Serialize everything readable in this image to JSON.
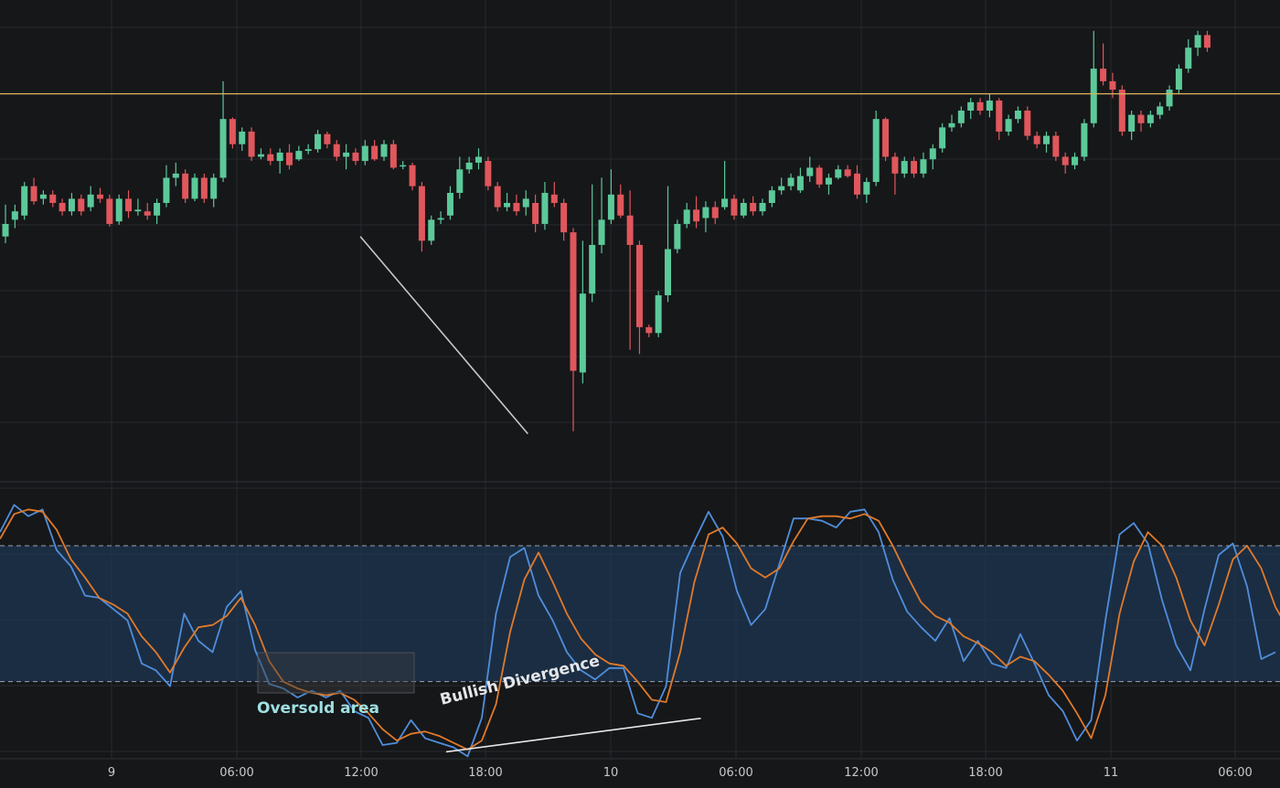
{
  "chart_data": [
    {
      "type": "candlestick",
      "title": "",
      "colors": {
        "up": "#5cc99a",
        "down": "#e0575c",
        "resistance": "#e0b15a",
        "grid": "#262a30"
      },
      "x_tick_labels": [
        "9",
        "06:00",
        "12:00",
        "18:00",
        "10",
        "06:00",
        "12:00",
        "18:00",
        "11",
        "06:00"
      ],
      "price_range": [
        -460,
        90
      ],
      "resistance_level": 0,
      "candles": [
        [
          -170,
          -155,
          -132,
          -178
        ],
        [
          -150,
          -140,
          -132,
          -160
        ],
        [
          -145,
          -110,
          -105,
          -150
        ],
        [
          -110,
          -128,
          -100,
          -132
        ],
        [
          -125,
          -120,
          -115,
          -132
        ],
        [
          -120,
          -130,
          -115,
          -135
        ],
        [
          -130,
          -140,
          -125,
          -145
        ],
        [
          -140,
          -125,
          -118,
          -145
        ],
        [
          -125,
          -140,
          -120,
          -145
        ],
        [
          -135,
          -120,
          -110,
          -140
        ],
        [
          -120,
          -125,
          -112,
          -130
        ],
        [
          -125,
          -155,
          -120,
          -158
        ],
        [
          -152,
          -125,
          -120,
          -156
        ],
        [
          -125,
          -140,
          -115,
          -148
        ],
        [
          -140,
          -138,
          -125,
          -145
        ],
        [
          -140,
          -145,
          -130,
          -150
        ],
        [
          -145,
          -130,
          -125,
          -155
        ],
        [
          -130,
          -100,
          -85,
          -135
        ],
        [
          -100,
          -95,
          -82,
          -110
        ],
        [
          -95,
          -125,
          -90,
          -130
        ],
        [
          -125,
          -100,
          -95,
          -128
        ],
        [
          -100,
          -125,
          -95,
          -130
        ],
        [
          -125,
          -100,
          -95,
          -135
        ],
        [
          -100,
          -30,
          15,
          -105
        ],
        [
          -30,
          -60,
          -28,
          -65
        ],
        [
          -60,
          -45,
          -40,
          -68
        ],
        [
          -45,
          -75,
          -40,
          -80
        ],
        [
          -75,
          -72,
          -65,
          -78
        ],
        [
          -72,
          -80,
          -65,
          -85
        ],
        [
          -80,
          -70,
          -65,
          -95
        ],
        [
          -70,
          -85,
          -60,
          -90
        ],
        [
          -78,
          -68,
          -62,
          -80
        ],
        [
          -68,
          -66,
          -60,
          -72
        ],
        [
          -66,
          -48,
          -43,
          -70
        ],
        [
          -48,
          -60,
          -45,
          -65
        ],
        [
          -60,
          -75,
          -55,
          -80
        ],
        [
          -75,
          -70,
          -60,
          -90
        ],
        [
          -70,
          -80,
          -65,
          -85
        ],
        [
          -80,
          -62,
          -55,
          -85
        ],
        [
          -62,
          -78,
          -55,
          -80
        ],
        [
          -75,
          -60,
          -55,
          -80
        ],
        [
          -60,
          -88,
          -55,
          -90
        ],
        [
          -86,
          -85,
          -80,
          -90
        ],
        [
          -85,
          -110,
          -82,
          -115
        ],
        [
          -110,
          -175,
          -105,
          -188
        ],
        [
          -175,
          -150,
          -145,
          -180
        ],
        [
          -150,
          -148,
          -140,
          -155
        ],
        [
          -145,
          -118,
          -110,
          -150
        ],
        [
          -118,
          -90,
          -75,
          -125
        ],
        [
          -90,
          -82,
          -75,
          -95
        ],
        [
          -82,
          -75,
          -65,
          -90
        ],
        [
          -80,
          -110,
          -75,
          -115
        ],
        [
          -110,
          -135,
          -105,
          -140
        ],
        [
          -135,
          -130,
          -118,
          -140
        ],
        [
          -130,
          -140,
          -120,
          -145
        ],
        [
          -135,
          -125,
          -115,
          -145
        ],
        [
          -130,
          -155,
          -120,
          -165
        ],
        [
          -155,
          -118,
          -105,
          -162
        ],
        [
          -120,
          -130,
          -105,
          -135
        ],
        [
          -130,
          -165,
          -125,
          -175
        ],
        [
          -165,
          -330,
          -160,
          -402
        ],
        [
          -332,
          -238,
          -175,
          -345
        ],
        [
          -238,
          -180,
          -108,
          -248
        ],
        [
          -180,
          -150,
          -100,
          -190
        ],
        [
          -150,
          -120,
          -90,
          -155
        ],
        [
          -120,
          -145,
          -108,
          -148
        ],
        [
          -145,
          -180,
          -115,
          -305
        ],
        [
          -180,
          -278,
          -175,
          -310
        ],
        [
          -278,
          -285,
          -275,
          -290
        ],
        [
          -285,
          -240,
          -235,
          -290
        ],
        [
          -240,
          -185,
          -110,
          -248
        ],
        [
          -185,
          -155,
          -150,
          -190
        ],
        [
          -155,
          -138,
          -130,
          -160
        ],
        [
          -138,
          -152,
          -122,
          -160
        ],
        [
          -148,
          -135,
          -128,
          -165
        ],
        [
          -135,
          -148,
          -128,
          -155
        ],
        [
          -135,
          -125,
          -80,
          -138
        ],
        [
          -125,
          -145,
          -120,
          -150
        ],
        [
          -145,
          -130,
          -125,
          -148
        ],
        [
          -130,
          -140,
          -122,
          -145
        ],
        [
          -140,
          -130,
          -125,
          -145
        ],
        [
          -130,
          -115,
          -110,
          -135
        ],
        [
          -115,
          -110,
          -100,
          -120
        ],
        [
          -110,
          -100,
          -95,
          -115
        ],
        [
          -115,
          -98,
          -88,
          -118
        ],
        [
          -98,
          -88,
          -75,
          -105
        ],
        [
          -88,
          -108,
          -85,
          -112
        ],
        [
          -108,
          -100,
          -95,
          -120
        ],
        [
          -100,
          -90,
          -85,
          -102
        ],
        [
          -90,
          -98,
          -85,
          -100
        ],
        [
          -95,
          -120,
          -85,
          -125
        ],
        [
          -120,
          -105,
          -100,
          -130
        ],
        [
          -105,
          -30,
          -20,
          -110
        ],
        [
          -30,
          -75,
          -28,
          -80
        ],
        [
          -75,
          -95,
          -70,
          -120
        ],
        [
          -95,
          -80,
          -75,
          -100
        ],
        [
          -80,
          -95,
          -75,
          -100
        ],
        [
          -95,
          -78,
          -70,
          -100
        ],
        [
          -78,
          -65,
          -60,
          -90
        ],
        [
          -65,
          -40,
          -35,
          -70
        ],
        [
          -40,
          -35,
          -25,
          -45
        ],
        [
          -35,
          -20,
          -15,
          -40
        ],
        [
          -20,
          -10,
          -5,
          -30
        ],
        [
          -10,
          -20,
          -5,
          -25
        ],
        [
          -20,
          -8,
          0,
          -28
        ],
        [
          -8,
          -45,
          -5,
          -55
        ],
        [
          -45,
          -30,
          -25,
          -50
        ],
        [
          -30,
          -20,
          -15,
          -35
        ],
        [
          -20,
          -50,
          -15,
          -55
        ],
        [
          -50,
          -60,
          -45,
          -65
        ],
        [
          -60,
          -50,
          -45,
          -70
        ],
        [
          -50,
          -75,
          -45,
          -80
        ],
        [
          -75,
          -85,
          -70,
          -95
        ],
        [
          -85,
          -75,
          -70,
          -90
        ],
        [
          -75,
          -35,
          -30,
          -80
        ],
        [
          -35,
          30,
          75,
          -40
        ],
        [
          30,
          15,
          60,
          10
        ],
        [
          15,
          5,
          25,
          -5
        ],
        [
          5,
          -45,
          10,
          -50
        ],
        [
          -45,
          -25,
          -20,
          -55
        ],
        [
          -25,
          -35,
          -20,
          -45
        ],
        [
          -35,
          -25,
          -20,
          -40
        ],
        [
          -25,
          -15,
          -10,
          -30
        ],
        [
          -15,
          5,
          10,
          -20
        ],
        [
          5,
          30,
          35,
          0
        ],
        [
          30,
          55,
          65,
          25
        ],
        [
          55,
          70,
          75,
          45
        ],
        [
          70,
          55,
          75,
          50
        ]
      ],
      "trendline": {
        "from_candle": 37.5,
        "from_price": -170,
        "to_candle": 55.2,
        "to_price": -405
      }
    },
    {
      "type": "line",
      "title": "",
      "y_range": [
        -10,
        105
      ],
      "bands": {
        "upper": 80,
        "lower": 20
      },
      "series": [
        {
          "color": "#4f8edb",
          "values": [
            86,
            98,
            93,
            96,
            78,
            71,
            58,
            57,
            52,
            47,
            28,
            25,
            18,
            50,
            38,
            33,
            53,
            60,
            34,
            19,
            17,
            13,
            16,
            13,
            16,
            7,
            4,
            -8,
            -7,
            3,
            -5,
            -7,
            -9,
            -13,
            4,
            50,
            75,
            79,
            58,
            47,
            33,
            25,
            21,
            26,
            26,
            6,
            4,
            18,
            68,
            82,
            95,
            84,
            60,
            45,
            52,
            72,
            92,
            92,
            91,
            88,
            95,
            96,
            86,
            65,
            51,
            44,
            38,
            48,
            29,
            38,
            28,
            26,
            41,
            28,
            14,
            7,
            -6,
            3,
            47,
            85,
            90,
            81,
            56,
            36,
            25,
            52,
            76,
            81,
            62,
            30,
            33
          ]
        },
        {
          "color": "#e07a2a",
          "values": [
            83,
            94,
            96,
            95,
            87,
            74,
            66,
            57,
            54,
            50,
            40,
            33,
            24,
            35,
            44,
            45,
            49,
            57,
            45,
            29,
            20,
            17,
            15,
            14,
            15,
            12,
            6,
            -1,
            -6,
            -3,
            -2,
            -4,
            -7,
            -10,
            -6,
            10,
            42,
            65,
            77,
            64,
            50,
            39,
            32,
            28,
            27,
            20,
            12,
            11,
            33,
            64,
            85,
            88,
            81,
            70,
            66,
            70,
            82,
            92,
            93,
            93,
            92,
            94,
            91,
            80,
            67,
            55,
            49,
            46,
            40,
            37,
            33,
            27,
            31,
            29,
            23,
            16,
            6,
            -5,
            14,
            50,
            73,
            86,
            80,
            66,
            47,
            36,
            54,
            74,
            80,
            70,
            53,
            42
          ]
        }
      ],
      "annotations": {
        "oversold_label": "Oversold area",
        "divergence_label": "Bullish Divergence"
      },
      "divergence": {
        "from_index": 32,
        "from_value": -11,
        "to_index": 47,
        "to_value": 3
      }
    }
  ]
}
